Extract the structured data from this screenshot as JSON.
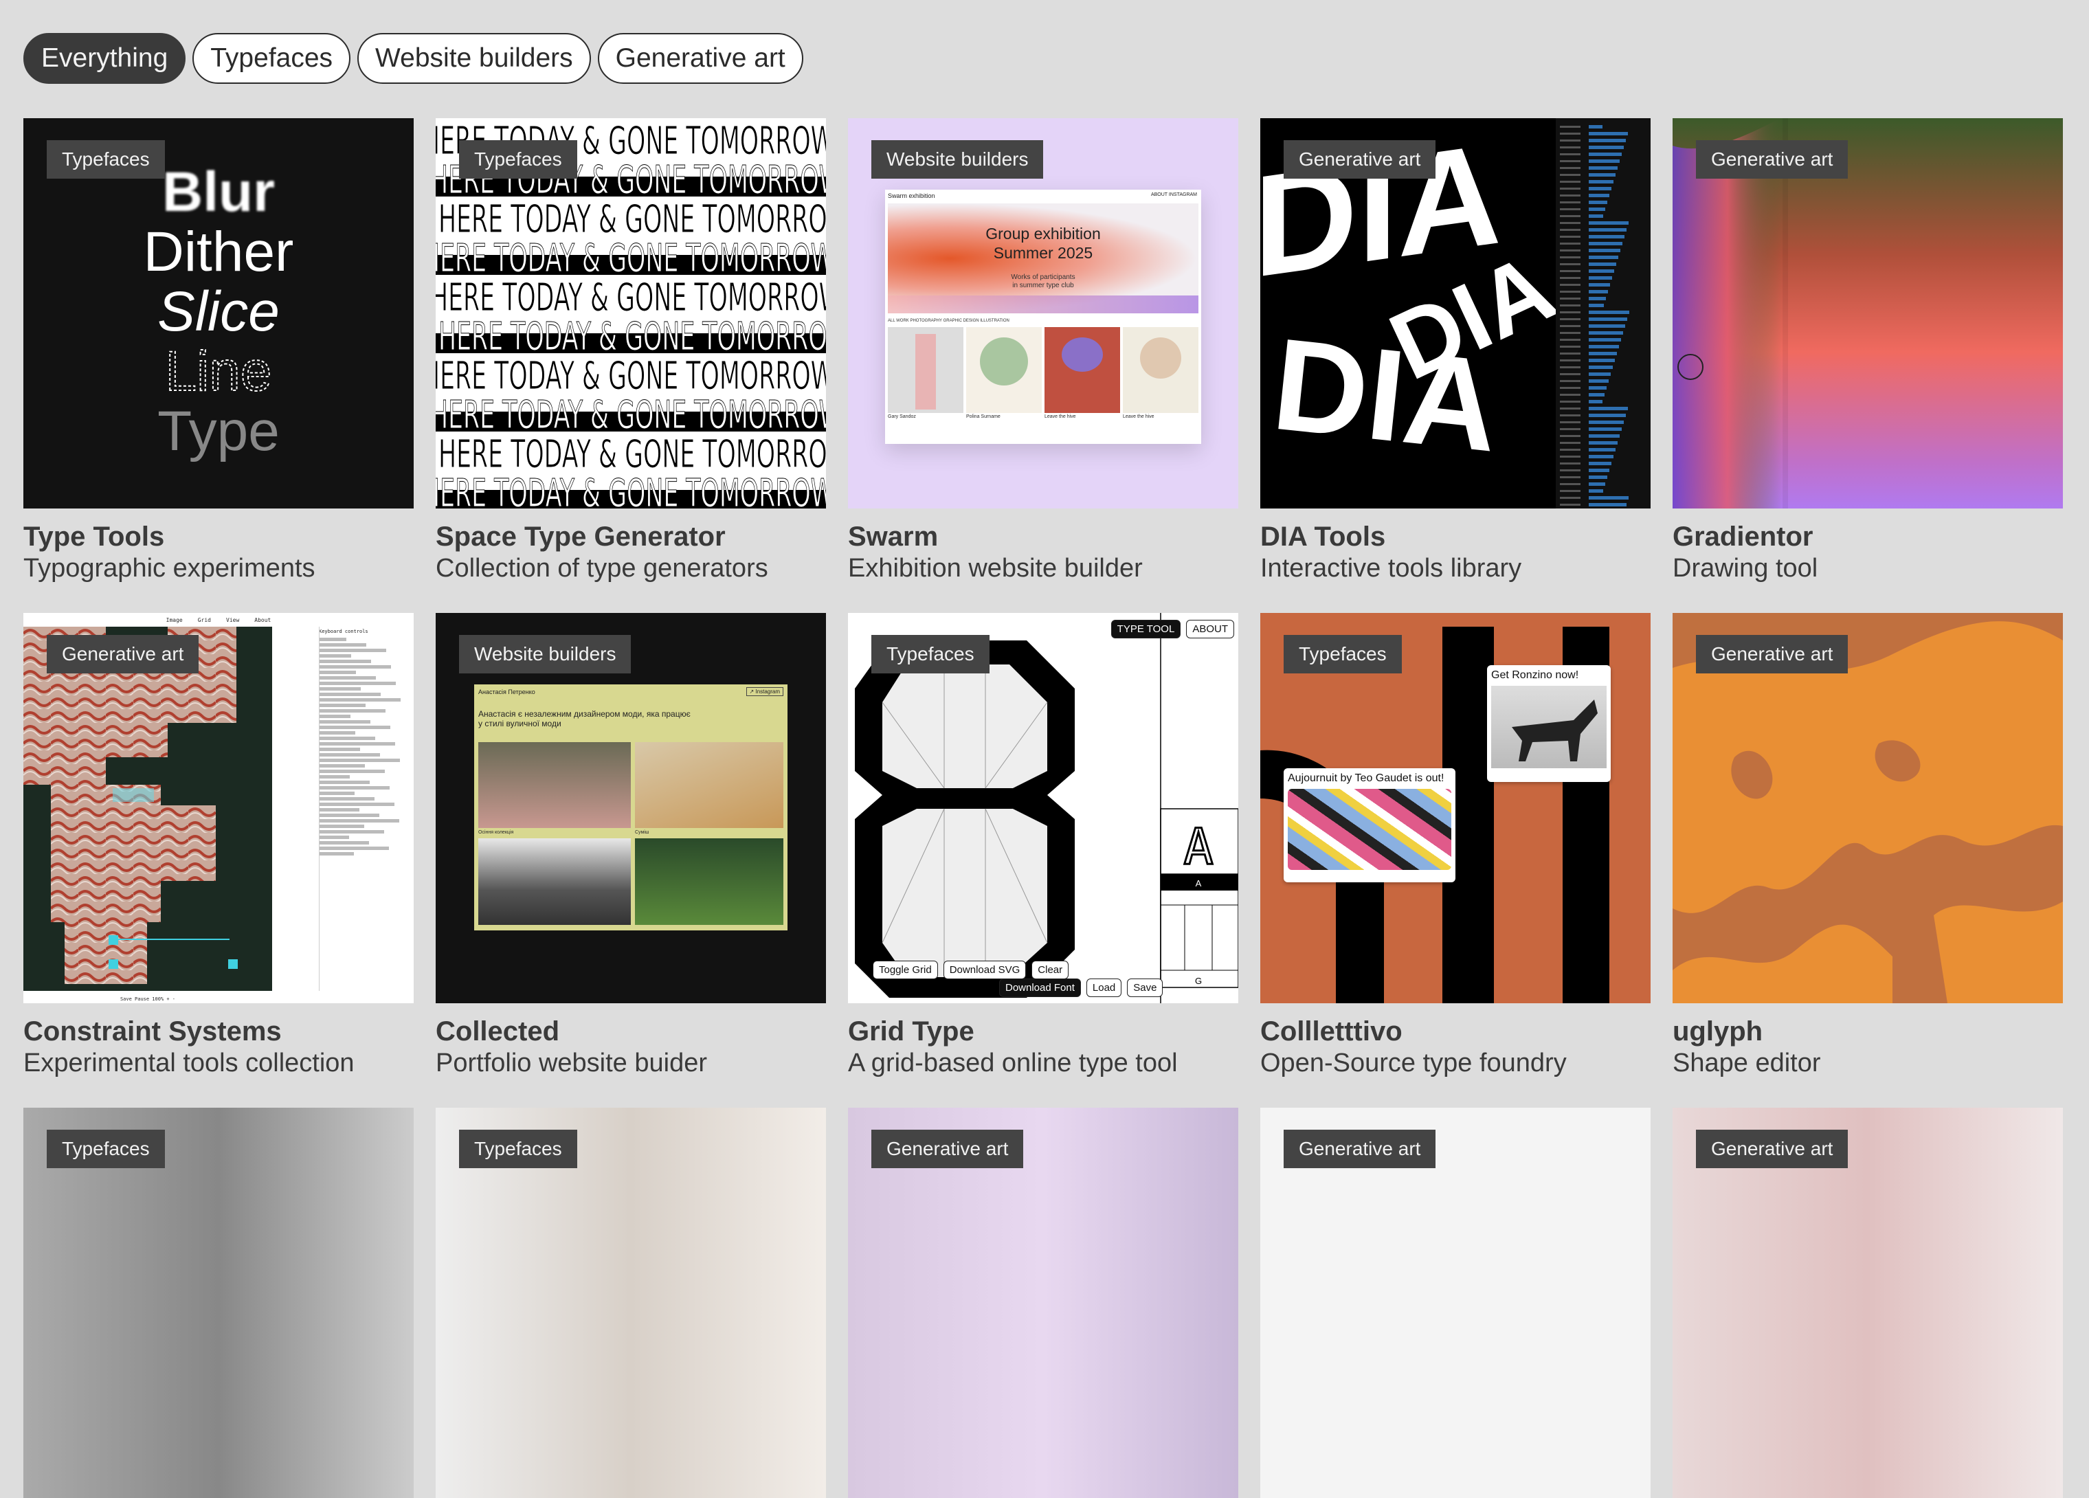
{
  "filters": [
    {
      "label": "Everything",
      "active": true
    },
    {
      "label": "Typefaces",
      "active": false
    },
    {
      "label": "Website builders",
      "active": false
    },
    {
      "label": "Generative art",
      "active": false
    }
  ],
  "cards": [
    {
      "tag": "Typefaces",
      "title": "Type Tools",
      "subtitle": "Typographic experiments",
      "preview": {
        "words": [
          "Blur",
          "Dither",
          "Slice",
          "Line",
          "Type"
        ]
      }
    },
    {
      "tag": "Typefaces",
      "title": "Space Type Generator",
      "subtitle": "Collection of type generators",
      "preview": {
        "line": "HERE TODAY & GONE TOMORROW"
      }
    },
    {
      "tag": "Website builders",
      "title": "Swarm",
      "subtitle": "Exhibition website builder",
      "preview": {
        "site_name": "Swarm exhibition",
        "nav": "ABOUT   INSTAGRAM",
        "headline1": "Group exhibition",
        "headline2": "Summer 2025",
        "caption1": "Works of participants",
        "caption2": "in summer type club",
        "filters": "ALL WORK   PHOTOGRAPHY   GRAPHIC DESIGN   ILLUSTRATION",
        "works": [
          "Gary Sandoz",
          "Polina Surname",
          "Leave the hive",
          "Leave the hive"
        ]
      }
    },
    {
      "tag": "Generative art",
      "title": "DIA Tools",
      "subtitle": "Interactive tools library",
      "preview": {
        "letters": "DIA"
      }
    },
    {
      "tag": "Generative art",
      "title": "Gradientor",
      "subtitle": "Drawing tool",
      "preview": {}
    },
    {
      "tag": "Generative art",
      "title": "Constraint Systems",
      "subtitle": "Experimental tools collection",
      "preview": {
        "menu": [
          "Image",
          "Grid",
          "View",
          "About"
        ],
        "panel_title": "Keyboard controls",
        "footer": "Save   Pause   100%   +   -"
      }
    },
    {
      "tag": "Website builders",
      "title": "Collected",
      "subtitle": "Portfolio website buider",
      "preview": {
        "name": "Анастасія Петренко",
        "link": "↗ Instagram",
        "bio1": "Анастасія є незалежним дизайнером моди, яка працює",
        "bio2": "у стилі вуличної моди",
        "captions": [
          "Осіння колекція",
          "Суміш"
        ]
      }
    },
    {
      "tag": "Typefaces",
      "title": "Grid Type",
      "subtitle": "A grid-based online type tool",
      "preview": {
        "header_buttons": [
          "TYPE TOOL",
          "ABOUT"
        ],
        "glyph": "A",
        "side_labels": [
          "A",
          "G"
        ],
        "buttons": [
          "Toggle Grid",
          "Download SVG",
          "Clear"
        ],
        "buttons2": [
          "Download Font",
          "Load",
          "Save"
        ]
      }
    },
    {
      "tag": "Typefaces",
      "title": "Collletttivo",
      "subtitle": "Open-Source type foundry",
      "preview": {
        "popup1": "Get Ronzino now!",
        "popup2": "Aujournuit by Teo Gaudet is out!"
      }
    },
    {
      "tag": "Generative art",
      "title": "uglyph",
      "subtitle": "Shape editor",
      "preview": {}
    }
  ],
  "next_row_tags": [
    "Typefaces",
    "Typefaces",
    "Generative art",
    "Generative art",
    "Generative art"
  ],
  "colors": {
    "page_bg": "#dddddd",
    "tag_bg": "#444444",
    "swarm_bg": "#e4d4f8",
    "collletttivo_orange": "#c8673f",
    "uglyph_orange": "#e98f34",
    "uglyph_rust": "#c0703f"
  }
}
